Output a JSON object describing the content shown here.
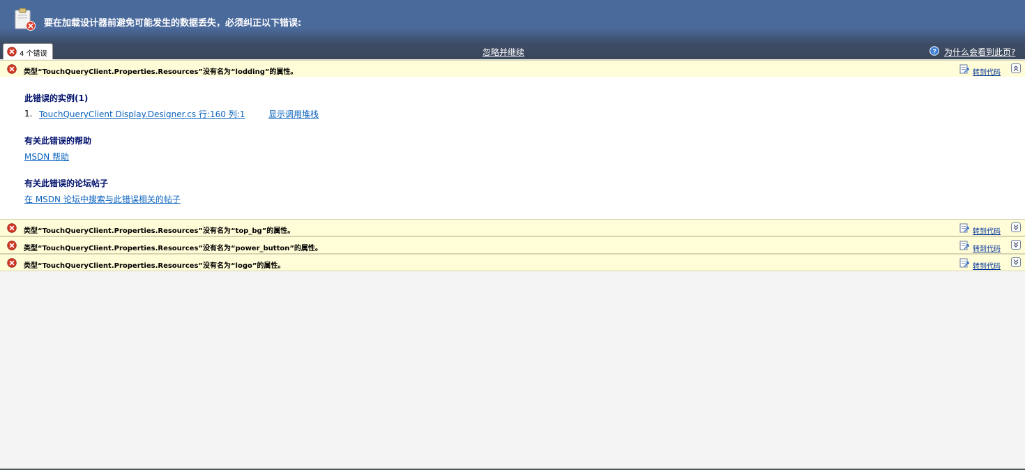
{
  "header": {
    "title": "要在加载设计器前避免可能发生的数据丢失，必须纠正以下错误:",
    "error_count_tab": "4 个错误",
    "ignore_continue": "忽略并继续",
    "why_link": "为什么会看到此页?"
  },
  "errors": [
    {
      "message": "类型“TouchQueryClient.Properties.Resources”没有名为“lodding”的属性。",
      "goto": "转到代码",
      "toggle": "collapse"
    },
    {
      "message": "类型“TouchQueryClient.Properties.Resources”没有名为“top_bg”的属性。",
      "goto": "转到代码",
      "toggle": "expand"
    },
    {
      "message": "类型“TouchQueryClient.Properties.Resources”没有名为“power_button”的属性。",
      "goto": "转到代码",
      "toggle": "expand"
    },
    {
      "message": "类型“TouchQueryClient.Properties.Resources”没有名为“logo”的属性。",
      "goto": "转到代码",
      "toggle": "expand"
    }
  ],
  "details": {
    "instances_title": "此错误的实例(1)",
    "instance_number": "1.",
    "instance_link": "TouchQueryClient Display.Designer.cs 行:160 列:1",
    "show_stack": "显示调用堆栈",
    "help_title": "有关此错误的帮助",
    "help_link": "MSDN 帮助",
    "forum_title": "有关此错误的论坛帖子",
    "forum_link": "在 MSDN 论坛中搜索与此错误相关的帖子"
  },
  "icons": {
    "error": "error-circle-icon",
    "designer": "clipboard-error-icon",
    "help": "help-circle-icon",
    "goto": "goto-code-icon",
    "collapse": "chevron-up-double-icon",
    "expand": "chevron-down-double-icon"
  },
  "colors": {
    "header_top": "#4b6a9c",
    "header_bottom": "#3a4559",
    "error_row_bg": "#fffcd8",
    "link": "#0c63c0",
    "section_title": "#00106b"
  }
}
